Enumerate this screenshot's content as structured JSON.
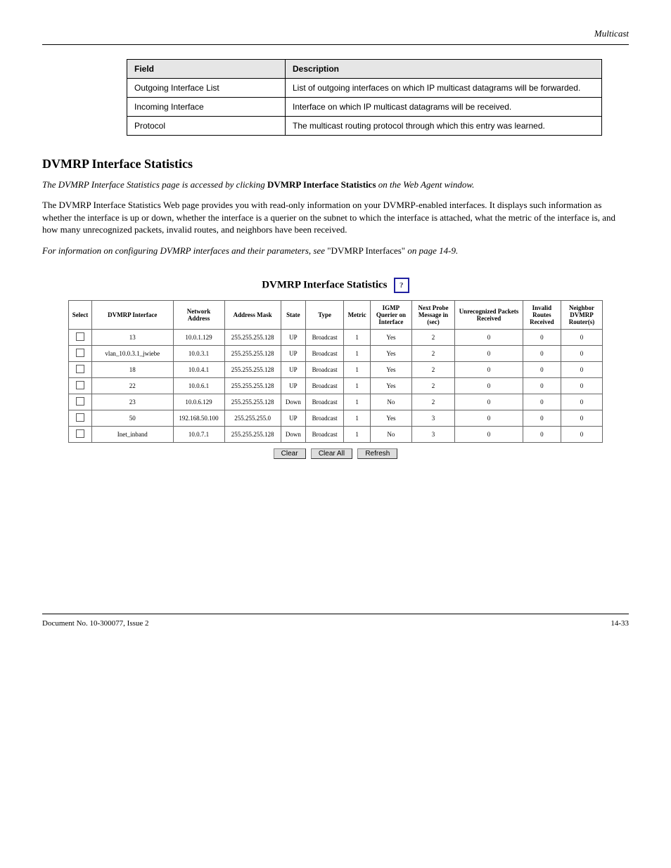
{
  "header": {
    "section_link": "Multicast",
    "hr": true
  },
  "field_table": {
    "headers": [
      "Field",
      "Description"
    ],
    "rows": [
      {
        "field": "Outgoing Interface List",
        "desc": "List of outgoing interfaces on which IP multicast datagrams will be forwarded."
      },
      {
        "field": "Incoming Interface",
        "desc": "Interface on which IP multicast datagrams will be received."
      },
      {
        "field": "Protocol",
        "desc": "The multicast routing protocol through which this entry was learned."
      }
    ]
  },
  "sections": {
    "title": "DVMRP Interface Statistics",
    "paragraphs": [
      "<em>The DVMRP Interface Statistics page is accessed by clicking</em> <b>DVMRP Interface Statistics</b> <em>on the Web Agent window.</em>",
      "The DVMRP Interface Statistics Web page provides you with read-only information on your DVMRP-enabled interfaces. It displays such information as whether the interface is up or down, whether the interface is a querier on the subnet to which the interface is attached, what the metric of the interface is, and how many unrecognized packets, invalid routes, and neighbors have been received.",
      "<em>For information on configuring DVMRP interfaces and their parameters, see</em> \"DVMRP Interfaces\" <em>on page 14-9.</em>"
    ]
  },
  "stats": {
    "title": "DVMRP Interface Statistics",
    "help_alt": "help-icon",
    "headers": [
      "Select",
      "DVMRP Interface",
      "Network Address",
      "Address Mask",
      "State",
      "Type",
      "Metric",
      "IGMP Querier on Interface",
      "Next Probe Message in (sec)",
      "Unrecognized Packets Received",
      "Invalid Routes Received",
      "Neighbor DVMRP Router(s)"
    ],
    "rows": [
      {
        "iface": "13",
        "net": "10.0.1.129",
        "mask": "255.255.255.128",
        "state": "UP",
        "type": "Broadcast",
        "metric": "1",
        "igmp": "Yes",
        "probe": "2",
        "unrec": "0",
        "inv": "0",
        "nbr": "0"
      },
      {
        "iface": "vlan_10.0.3.1_jwiebe",
        "net": "10.0.3.1",
        "mask": "255.255.255.128",
        "state": "UP",
        "type": "Broadcast",
        "metric": "1",
        "igmp": "Yes",
        "probe": "2",
        "unrec": "0",
        "inv": "0",
        "nbr": "0"
      },
      {
        "iface": "18",
        "net": "10.0.4.1",
        "mask": "255.255.255.128",
        "state": "UP",
        "type": "Broadcast",
        "metric": "1",
        "igmp": "Yes",
        "probe": "2",
        "unrec": "0",
        "inv": "0",
        "nbr": "0"
      },
      {
        "iface": "22",
        "net": "10.0.6.1",
        "mask": "255.255.255.128",
        "state": "UP",
        "type": "Broadcast",
        "metric": "1",
        "igmp": "Yes",
        "probe": "2",
        "unrec": "0",
        "inv": "0",
        "nbr": "0"
      },
      {
        "iface": "23",
        "net": "10.0.6.129",
        "mask": "255.255.255.128",
        "state": "Down",
        "type": "Broadcast",
        "metric": "1",
        "igmp": "No",
        "probe": "2",
        "unrec": "0",
        "inv": "0",
        "nbr": "0"
      },
      {
        "iface": "50",
        "net": "192.168.50.100",
        "mask": "255.255.255.0",
        "state": "UP",
        "type": "Broadcast",
        "metric": "1",
        "igmp": "Yes",
        "probe": "3",
        "unrec": "0",
        "inv": "0",
        "nbr": "0"
      },
      {
        "iface": "Inet_inband",
        "net": "10.0.7.1",
        "mask": "255.255.255.128",
        "state": "Down",
        "type": "Broadcast",
        "metric": "1",
        "igmp": "No",
        "probe": "3",
        "unrec": "0",
        "inv": "0",
        "nbr": "0"
      }
    ],
    "buttons": {
      "clear": "Clear",
      "clear_all": "Clear All",
      "refresh": "Refresh"
    }
  },
  "footer": {
    "left": "Document No. 10-300077, Issue 2",
    "right": "14-33"
  }
}
